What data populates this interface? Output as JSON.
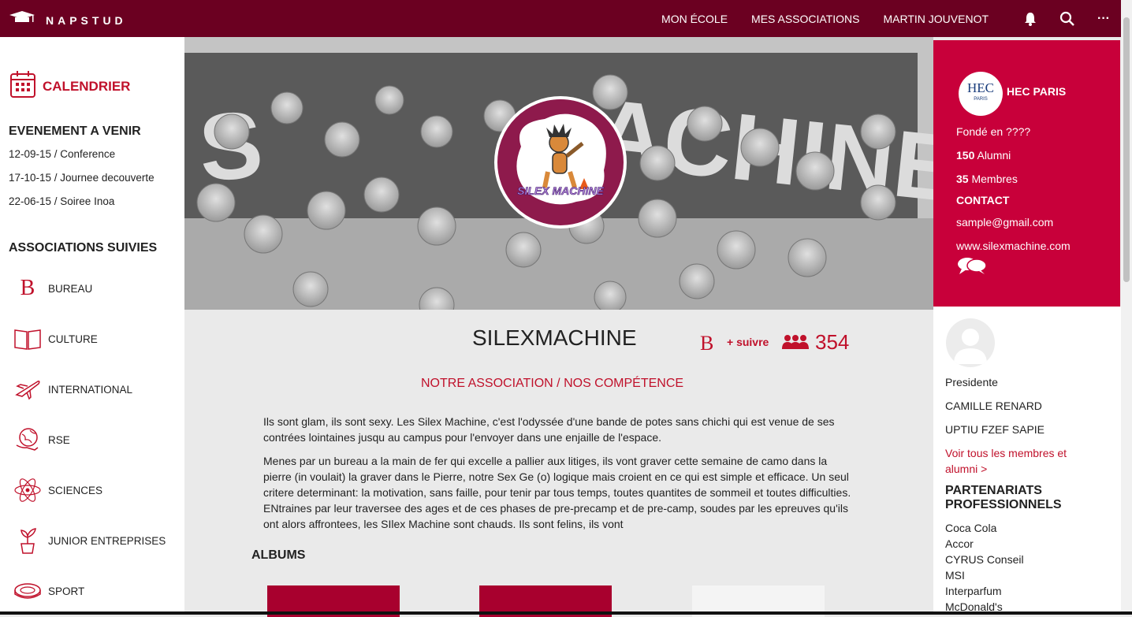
{
  "header": {
    "brand": "NAPSTUD",
    "nav": [
      "MON ÉCOLE",
      "MES ASSOCIATIONS",
      "MARTIN JOUVENOT"
    ],
    "more": "···"
  },
  "sidebar": {
    "calendar_label": "CALENDRIER",
    "events_title": "EVENEMENT A VENIR",
    "events": [
      "12-09-15 / Conference",
      "17-10-15 / Journee decouverte",
      "22-06-15 / Soiree Inoa"
    ],
    "assos_title": "ASSOCIATIONS SUIVIES",
    "assos": [
      {
        "label": "BUREAU",
        "icon": "bureau-b-icon"
      },
      {
        "label": "CULTURE",
        "icon": "book-icon"
      },
      {
        "label": "INTERNATIONAL",
        "icon": "plane-icon"
      },
      {
        "label": "RSE",
        "icon": "globe-hand-icon"
      },
      {
        "label": "SCIENCES",
        "icon": "atom-icon"
      },
      {
        "label": "JUNIOR ENTREPRISES",
        "icon": "plant-icon"
      },
      {
        "label": "SPORT",
        "icon": "stadium-icon"
      }
    ]
  },
  "main": {
    "logo_text": "SILEX MACHINE",
    "name": "SILEXMACHINE",
    "follow_label": "+ suivre",
    "member_count": "354",
    "subtitle": "NOTRE ASSOCIATION / NOS COMPÉTENCE",
    "paragraphs": [
      "Ils sont glam, ils sont sexy. Les Silex Machine, c'est l'odyssée d'une bande de potes sans chichi qui est venue de ses contrées lointaines jusqu au campus pour l'envoyer dans une enjaille de l'espace.",
      "Menes par un bureau a la main de fer qui excelle a pallier aux litiges, ils vont graver cette semaine de camo dans la pierre (in voulait) la graver dans le Pierre, notre Sex Ge (o) logique mais croient en ce qui est simple et efficace. Un seul critere determinant: la motivation, sans faille, pour tenir par tous temps, toutes quantites de sommeil et toutes difficulties. ENtraines par leur traversee des ages et de ces phases de pre-precamp et de pre-camp, soudes par les epreuves qu'ils ont alors affrontees, les SIlex Machine sont chauds. Ils sont felins, ils vont"
    ],
    "albums_title": "ALBUMS",
    "album_colors": [
      "#a8002e",
      "#a8002e",
      "#f4f4f4"
    ]
  },
  "school": {
    "logo_text": "HEC",
    "logo_sub": "PARIS",
    "name": "HEC PARIS",
    "founded": "Fondé en ????",
    "alumni_count": "150",
    "alumni_label": " Alumni",
    "members_count": "35",
    "members_label": " Membres",
    "contact_title": "CONTACT",
    "email": "sample@gmail.com",
    "website": "www.silexmachine.com"
  },
  "team": {
    "role": "Presidente",
    "members": [
      "CAMILLE RENARD",
      "UPTIU FZEF SAPIE"
    ],
    "see_all": "Voir tous les membres et alumni >"
  },
  "partners": {
    "title": "PARTENARIATS PROFESSIONNELS",
    "items": [
      "Coca Cola",
      "Accor",
      "CYRUS Conseil",
      "MSI",
      "Interparfum",
      "McDonald's"
    ]
  },
  "colors": {
    "brand": "#6b0021",
    "accent": "#c0112b",
    "card": "#c8003a"
  }
}
